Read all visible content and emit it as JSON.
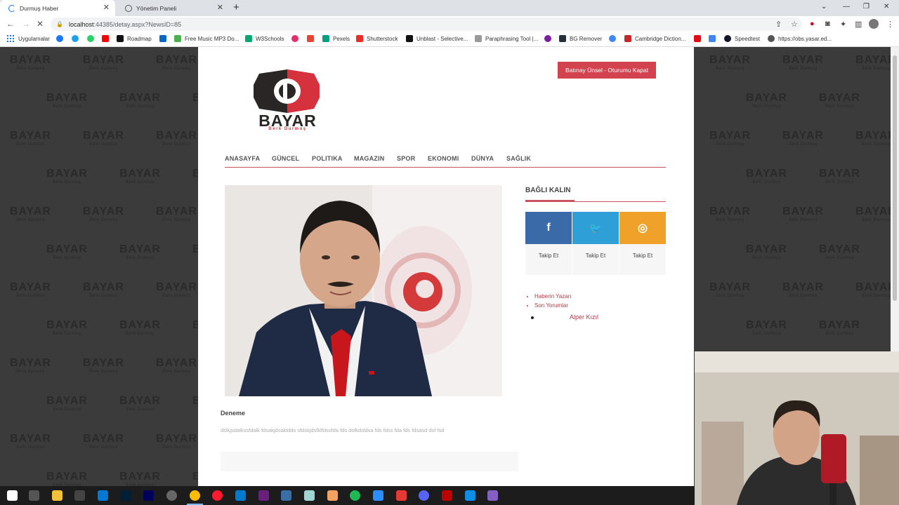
{
  "browser": {
    "tabs": [
      {
        "title": "Durmuş Haber",
        "active": true,
        "state": "loading"
      },
      {
        "title": "Yönetim Paneli",
        "active": false
      }
    ],
    "url_host": "localhost",
    "url_rest": ":44385/detay.aspx?NewsID=85",
    "bookmarks": [
      "Uygulamalar",
      "Roadmap",
      "Free Music MP3 Do...",
      "W3Schools",
      "Pexels",
      "Shutterstock",
      "Unblast - Selective...",
      "Paraphrasing Tool |...",
      "BG Remover",
      "Cambridge Diction...",
      "Speedtest",
      "https://obs.yasar.ed..."
    ]
  },
  "page": {
    "logout_label": "Batınay Ünsel - Oturumu Kapat",
    "logo_brand": "BAYAR",
    "logo_sub": "Berk Durmuş",
    "nav": [
      "ANASAYFA",
      "GÜNCEL",
      "POLITIKA",
      "MAGAZIN",
      "SPOR",
      "EKONOMI",
      "DÜNYA",
      "SAĞLIK"
    ],
    "news_title": "Deneme",
    "news_body": "dslkjsdalkssfdalk fdsakjdsakldds sfdskjdsfklfdssfda fds dsfkdsldsa fds fdss fda fds fdsasd dsf fsd",
    "sidebar_title": "BAĞLI KALIN",
    "social": [
      {
        "icon": "facebook-icon",
        "glyph": "f",
        "label": "Takip Et",
        "color": "#3b6aa8"
      },
      {
        "icon": "twitter-icon",
        "glyph": "🐦",
        "label": "Takip Et",
        "color": "#2f9fd8"
      },
      {
        "icon": "instagram-icon",
        "glyph": "◎",
        "label": "Takip Et",
        "color": "#f0a12a"
      }
    ],
    "links": [
      "Haberin Yazarı",
      "Son Yorumlar"
    ],
    "author": "Alper Kızıl",
    "watermark_brand": "BAYAR",
    "watermark_sub": "Berk Durmuş"
  },
  "colors": {
    "accent": "#c9545e",
    "logout_bg": "#d2434f",
    "logo_red": "#d6323e",
    "logo_dark": "#2a2626"
  }
}
